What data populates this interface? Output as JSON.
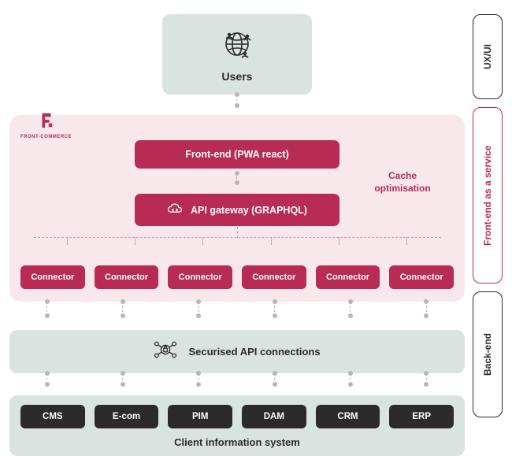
{
  "brand": {
    "name": "FRONT-COMMERCE"
  },
  "users": {
    "label": "Users"
  },
  "frontend": {
    "pwa_label": "Front-end (PWA react)",
    "api_gateway_label": "API gateway (GRAPHQL)",
    "cache_label": "Cache optimisation",
    "connectors": [
      "Connector",
      "Connector",
      "Connector",
      "Connector",
      "Connector",
      "Connector"
    ]
  },
  "secure_api": {
    "label": "Securised API connections"
  },
  "client_system": {
    "title": "Client information system",
    "systems": [
      "CMS",
      "E-com",
      "PIM",
      "DAM",
      "CRM",
      "ERP"
    ]
  },
  "side_labels": {
    "uxui": "UX/UI",
    "feaas": "Front-end as a service",
    "backend": "Back-end"
  }
}
